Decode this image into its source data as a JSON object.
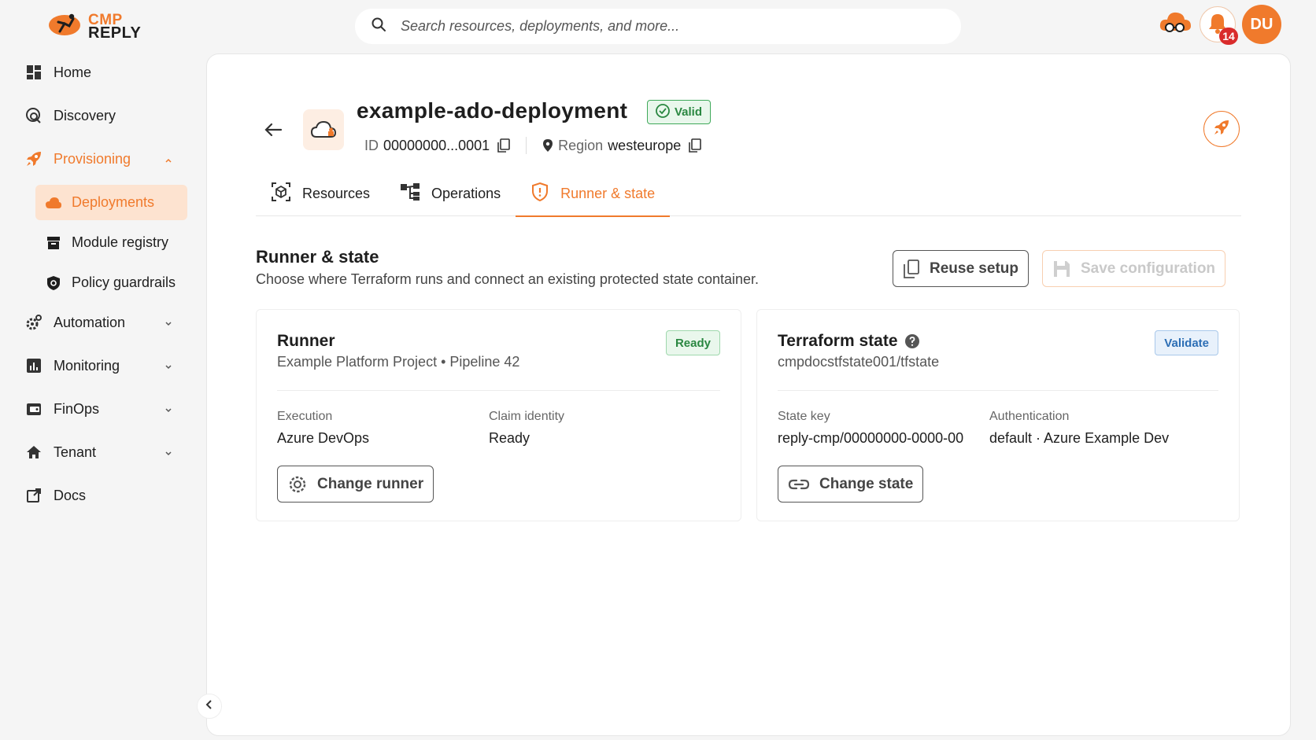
{
  "brand": {
    "line1": "CMP",
    "line2": "REPLY",
    "accent": "#f07a2c"
  },
  "search": {
    "placeholder": "Search resources, deployments, and more..."
  },
  "topbar": {
    "notification_count": "14",
    "avatar_initials": "DU"
  },
  "sidebar": {
    "items": [
      {
        "label": "Home",
        "icon": "dashboard-icon"
      },
      {
        "label": "Discovery",
        "icon": "discovery-icon"
      },
      {
        "label": "Provisioning",
        "icon": "rocket-icon",
        "expanded": true
      },
      {
        "label": "Automation",
        "icon": "gear-icon"
      },
      {
        "label": "Monitoring",
        "icon": "chart-icon"
      },
      {
        "label": "FinOps",
        "icon": "wallet-icon"
      },
      {
        "label": "Tenant",
        "icon": "home-icon"
      },
      {
        "label": "Docs",
        "icon": "external-link-icon"
      }
    ],
    "provisioning_children": [
      {
        "label": "Deployments",
        "icon": "cloud-icon",
        "active": true
      },
      {
        "label": "Module registry",
        "icon": "archive-icon"
      },
      {
        "label": "Policy guardrails",
        "icon": "shield-icon"
      }
    ]
  },
  "deployment": {
    "name": "example-ado-deployment",
    "status": "Valid",
    "id_label": "ID",
    "id_value": "00000000...0001",
    "region_label": "Region",
    "region_value": "westeurope"
  },
  "tabs": [
    {
      "label": "Resources",
      "icon": "cube-icon"
    },
    {
      "label": "Operations",
      "icon": "hierarchy-icon"
    },
    {
      "label": "Runner & state",
      "icon": "shield-alert-icon",
      "active": true
    }
  ],
  "section": {
    "title": "Runner & state",
    "description": "Choose where Terraform runs and connect an existing protected state container.",
    "reuse_label": "Reuse setup",
    "save_label": "Save configuration"
  },
  "runner_card": {
    "title": "Runner",
    "subtitle": "Example Platform Project • Pipeline 42",
    "badge": "Ready",
    "execution_label": "Execution",
    "execution_value": "Azure DevOps",
    "claim_label": "Claim identity",
    "claim_value": "Ready",
    "button_label": "Change runner"
  },
  "state_card": {
    "title": "Terraform state",
    "subtitle": "cmpdocstfstate001/tfstate",
    "badge": "Validate",
    "key_label": "State key",
    "key_value": "reply-cmp/00000000-0000-00",
    "auth_label": "Authentication",
    "auth_value": "default · Azure Example Dev",
    "button_label": "Change state"
  }
}
